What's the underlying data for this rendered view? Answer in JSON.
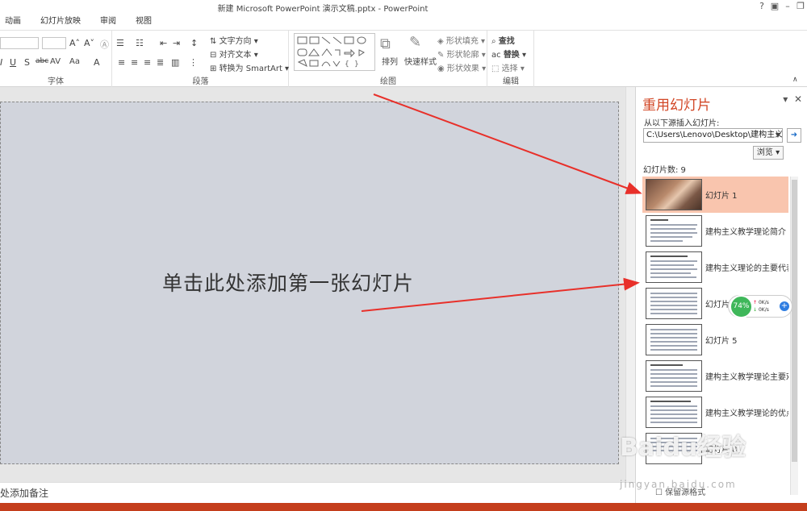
{
  "window": {
    "title": "新建 Microsoft PowerPoint 演示文稿.pptx - PowerPoint"
  },
  "menu_tabs": [
    "动画",
    "幻灯片放映",
    "审阅",
    "视图"
  ],
  "ribbon": {
    "groups": {
      "font": "字体",
      "paragraph": "段落",
      "drawing": "绘图",
      "editing": "编辑"
    },
    "text_direction": "文字方向",
    "align_text": "对齐文本",
    "smartart": "转换为 SmartArt",
    "arrange": "排列",
    "quick_styles": "快速样式",
    "shape_fill": "形状填充",
    "shape_outline": "形状轮廓",
    "shape_effects": "形状效果",
    "find": "查找",
    "replace": "替换",
    "select": "选择"
  },
  "slide": {
    "placeholder": "单击此处添加第一张幻灯片"
  },
  "notes": {
    "label": "处添加备注"
  },
  "reuse_pane": {
    "title": "重用幻灯片",
    "insert_from_label": "从以下源插入幻灯片:",
    "path": "C:\\Users\\Lenovo\\Desktop\\建构主义",
    "browse": "浏览",
    "count_label": "幻灯片数: 9",
    "slides": [
      {
        "label": "幻灯片 1",
        "selected": true,
        "kind": "photo"
      },
      {
        "label": "建构主义教学理论简介",
        "selected": false,
        "kind": "text"
      },
      {
        "label": "建构主义理论的主要代表",
        "selected": false,
        "kind": "text"
      },
      {
        "label": "幻灯片",
        "selected": false,
        "kind": "text"
      },
      {
        "label": "幻灯片 5",
        "selected": false,
        "kind": "text"
      },
      {
        "label": "建构主义教学理论主要观",
        "selected": false,
        "kind": "text"
      },
      {
        "label": "建构主义教学理论的优点",
        "selected": false,
        "kind": "text"
      },
      {
        "label": "幻灯片 8",
        "selected": false,
        "kind": "text"
      }
    ],
    "footer": "保留源格式"
  },
  "network_widget": {
    "percent": "74%",
    "up": "0K/s",
    "down": "0K/s"
  },
  "watermark": {
    "text": "Baidu经验",
    "url": "jingyan.baidu.com"
  },
  "colors": {
    "accent": "#d24726",
    "selected": "#f9c5ae",
    "statusbar": "#c43e1c",
    "arrow": "#e8302a"
  }
}
